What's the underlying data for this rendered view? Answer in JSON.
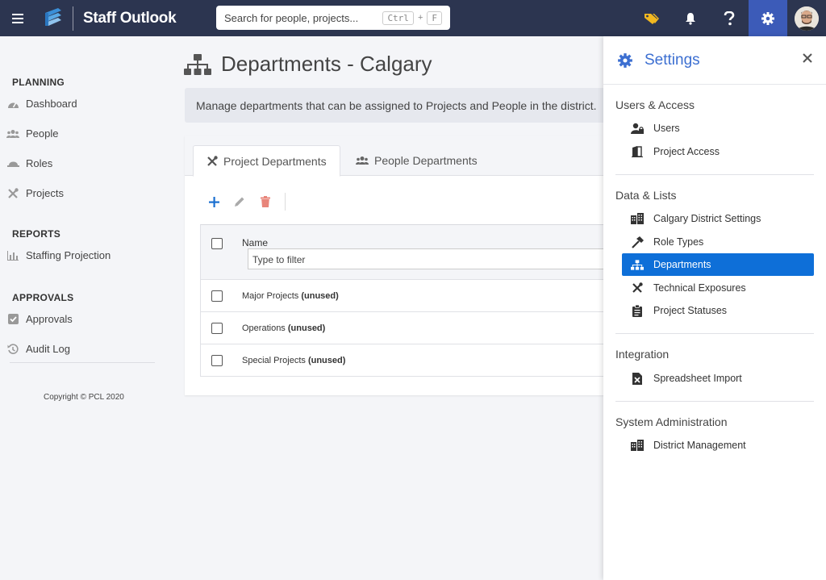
{
  "app": {
    "brand": "Staff Outlook"
  },
  "search": {
    "placeholder": "Search for people, projects...",
    "shortcut_key1": "Ctrl",
    "shortcut_plus": "+",
    "shortcut_key2": "F"
  },
  "topbar": {
    "icons": [
      "tag-icon",
      "bell-icon",
      "help-icon",
      "gear-icon",
      "avatar"
    ]
  },
  "sidebar": {
    "sections": [
      {
        "title": "PLANNING",
        "items": [
          {
            "label": "Dashboard",
            "icon": "dashboard-icon"
          },
          {
            "label": "People",
            "icon": "people-icon"
          },
          {
            "label": "Roles",
            "icon": "roles-icon"
          },
          {
            "label": "Projects",
            "icon": "tools-icon"
          }
        ]
      },
      {
        "title": "REPORTS",
        "items": [
          {
            "label": "Staffing Projection",
            "icon": "bar-chart-icon"
          }
        ]
      },
      {
        "title": "APPROVALS",
        "items": [
          {
            "label": "Approvals",
            "icon": "checkbox-icon"
          },
          {
            "label": "Audit Log",
            "icon": "history-icon"
          }
        ]
      }
    ],
    "copyright": "Copyright © PCL 2020"
  },
  "main": {
    "title": "Departments - Calgary",
    "intro": "Manage departments that can be assigned to Projects and People in the district.",
    "tabs": [
      {
        "label": "Project Departments"
      },
      {
        "label": "People Departments"
      }
    ],
    "grid": {
      "column_name": "Name",
      "filter_placeholder": "Type to filter",
      "rows": [
        {
          "name": "Major Projects",
          "tag": "(unused)"
        },
        {
          "name": "Operations",
          "tag": "(unused)"
        },
        {
          "name": "Special Projects",
          "tag": "(unused)"
        }
      ]
    }
  },
  "settings": {
    "title": "Settings",
    "sections": [
      {
        "title": "Users & Access",
        "items": [
          {
            "label": "Users",
            "icon": "user-lock-icon"
          },
          {
            "label": "Project Access",
            "icon": "door-icon"
          }
        ]
      },
      {
        "title": "Data & Lists",
        "items": [
          {
            "label": "Calgary District Settings",
            "icon": "buildings-icon"
          },
          {
            "label": "Role Types",
            "icon": "hammer-icon"
          },
          {
            "label": "Departments",
            "icon": "sitemap-icon",
            "selected": true
          },
          {
            "label": "Technical Exposures",
            "icon": "tools-icon"
          },
          {
            "label": "Project Statuses",
            "icon": "clipboard-icon"
          }
        ]
      },
      {
        "title": "Integration",
        "items": [
          {
            "label": "Spreadsheet Import",
            "icon": "excel-file-icon"
          }
        ]
      },
      {
        "title": "System Administration",
        "items": [
          {
            "label": "District Management",
            "icon": "buildings-icon"
          }
        ]
      }
    ]
  },
  "colors": {
    "topbar": "#2c3550",
    "accent": "#3c6fd1",
    "selected": "#0e6fd8",
    "delete": "#e8857a"
  }
}
